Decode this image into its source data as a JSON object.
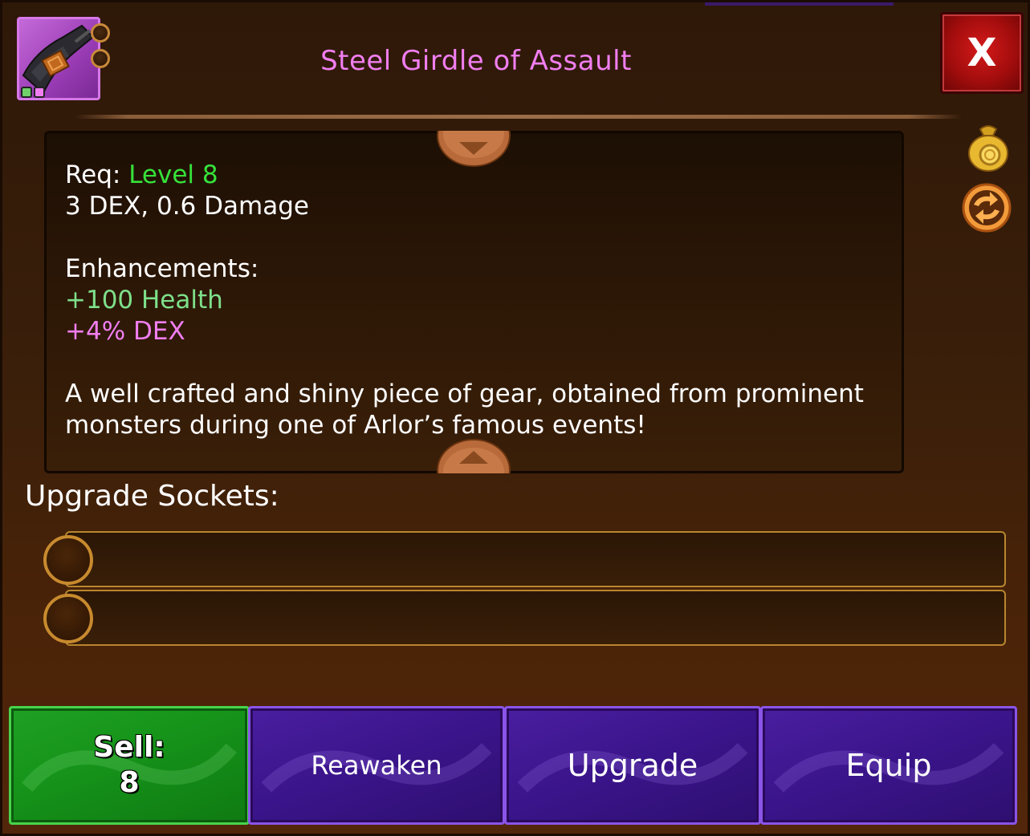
{
  "item": {
    "title": "Steel Girdle of Assault",
    "icon": "belt-item-icon",
    "rarity_color": "#c46ad8"
  },
  "header": {
    "close_label": "X"
  },
  "side_actions": [
    {
      "icon": "gold-bag-icon"
    },
    {
      "icon": "swap-arrows-icon"
    }
  ],
  "details": {
    "req_label": "Req:",
    "req_value": "Level 8",
    "stats": "3 DEX, 0.6 Damage",
    "enhancements_label": "Enhancements:",
    "enhancements": [
      {
        "text": "+100 Health",
        "color": "#7ee08a"
      },
      {
        "text": "+4% DEX",
        "color": "#f07ef0"
      }
    ],
    "description_lines": [
      "A well crafted and shiny piece of gear, obtained from prominent",
      "monsters during one of Arlor’s famous events!"
    ]
  },
  "sockets": {
    "label": "Upgrade Sockets:",
    "slots": [
      {
        "status": "empty"
      },
      {
        "status": "empty"
      }
    ]
  },
  "actions": {
    "sell_label": "Sell:",
    "sell_value": "8",
    "reawaken_label": "Reawaken",
    "upgrade_label": "Upgrade",
    "equip_label": "Equip"
  },
  "colors": {
    "title": "#f07ef0",
    "level": "#36e23a",
    "sell_green": "#16941a",
    "purple_button": "#3a148a",
    "close_red": "#a40d0d"
  }
}
